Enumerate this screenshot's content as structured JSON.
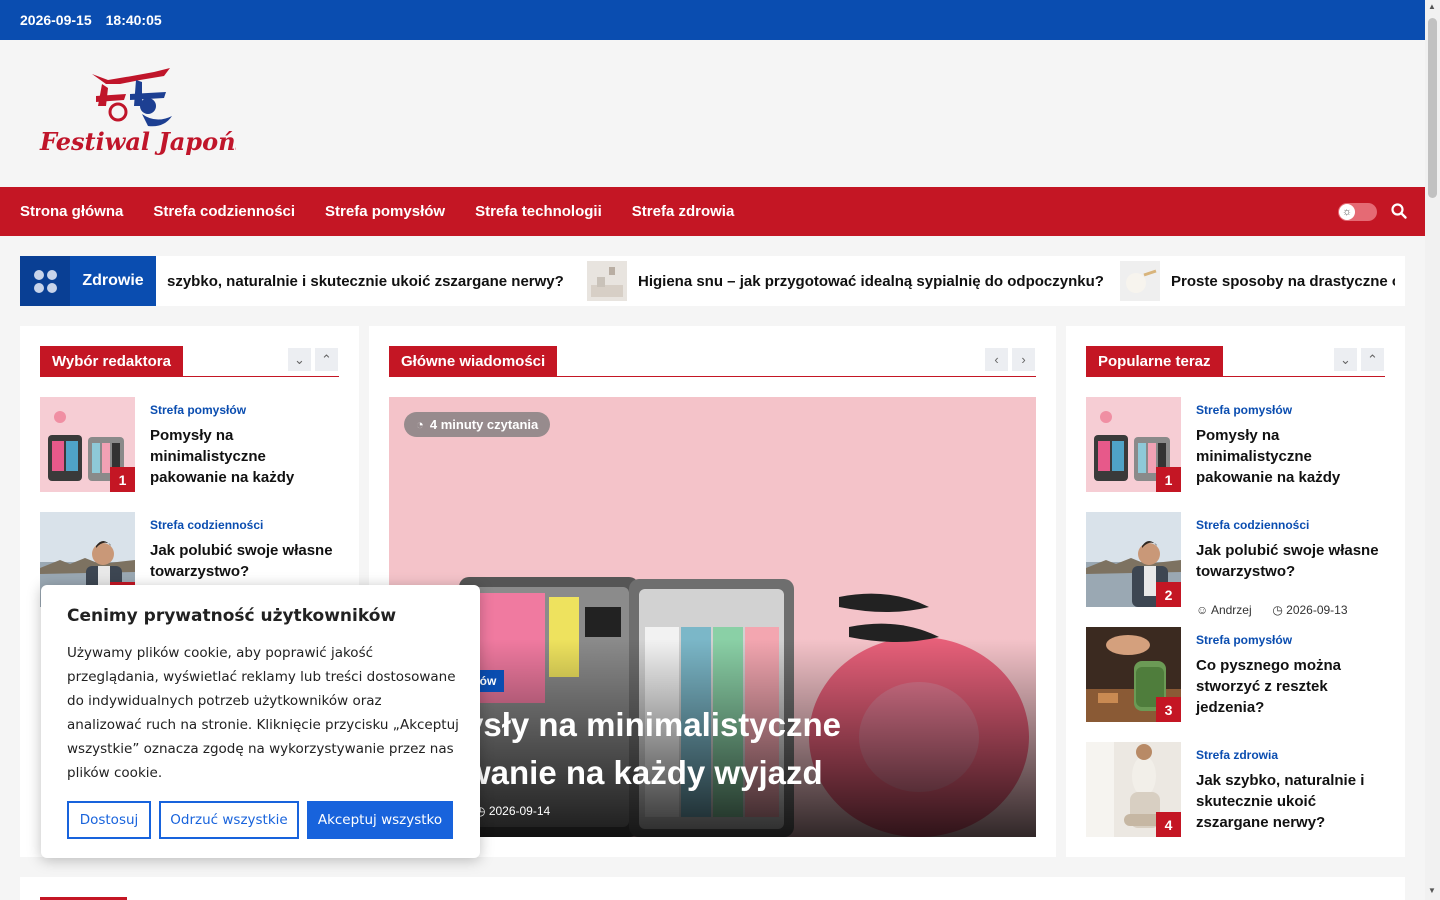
{
  "topbar": {
    "date": "2026-09-15",
    "time": "18:40:05"
  },
  "logo": {
    "text": "Festiwal Japoński"
  },
  "nav": {
    "items": [
      "Strona główna",
      "Strefa codzienności",
      "Strefa pomysłów",
      "Strefa technologii",
      "Strefa zdrowia"
    ]
  },
  "ticker": {
    "label": "Zdrowie",
    "items": [
      "szybko, naturalnie i skutecznie ukoić zszargane nerwy?",
      "Higiena snu – jak przygotować idealną sypialnię do odpoczynku?",
      "Proste sposoby na drastyczne og"
    ]
  },
  "editors": {
    "title": "Wybór redaktora",
    "articles": [
      {
        "num": "1",
        "category": "Strefa pomysłów",
        "title": "Pomysły na minimalistyczne pakowanie na każdy"
      },
      {
        "num": "2",
        "category": "Strefa codzienności",
        "title": "Jak polubić swoje własne towarzystwo?"
      }
    ]
  },
  "main_news": {
    "title": "Główne wiadomości",
    "hero": {
      "read_time": "4 minuty czytania",
      "category": "ysłów",
      "title": "ysły na minimalistyczne\nwanie na każdy wyjazd",
      "date": "2026-09-14"
    }
  },
  "popular": {
    "title": "Popularne teraz",
    "articles": [
      {
        "num": "1",
        "category": "Strefa pomysłów",
        "title": "Pomysły na minimalistyczne pakowanie na każdy"
      },
      {
        "num": "2",
        "category": "Strefa codzienności",
        "title": "Jak polubić swoje własne towarzystwo?",
        "author": "Andrzej",
        "date": "2026-09-13"
      },
      {
        "num": "3",
        "category": "Strefa pomysłów",
        "title": "Co pysznego można stworzyć z resztek jedzenia?"
      },
      {
        "num": "4",
        "category": "Strefa zdrowia",
        "title": "Jak szybko, naturalnie i skutecznie ukoić zszargane nerwy?"
      }
    ]
  },
  "cookie": {
    "title": "Cenimy prywatność użytkowników",
    "text": "Używamy plików cookie, aby poprawić jakość przeglądania, wyświetlać reklamy lub treści dostosowane do indywidualnych potrzeb użytkowników oraz analizować ruch na stronie. Kliknięcie przycisku „Akceptuj wszystkie” oznacza zgodę na wykorzystywanie przez nas plików cookie.",
    "btn_customize": "Dostosuj",
    "btn_reject": "Odrzuć wszystkie",
    "btn_accept": "Akceptuj wszystko"
  },
  "colors": {
    "blue": "#0a4db0",
    "red": "#c41624",
    "cookie_blue": "#1863dc"
  }
}
